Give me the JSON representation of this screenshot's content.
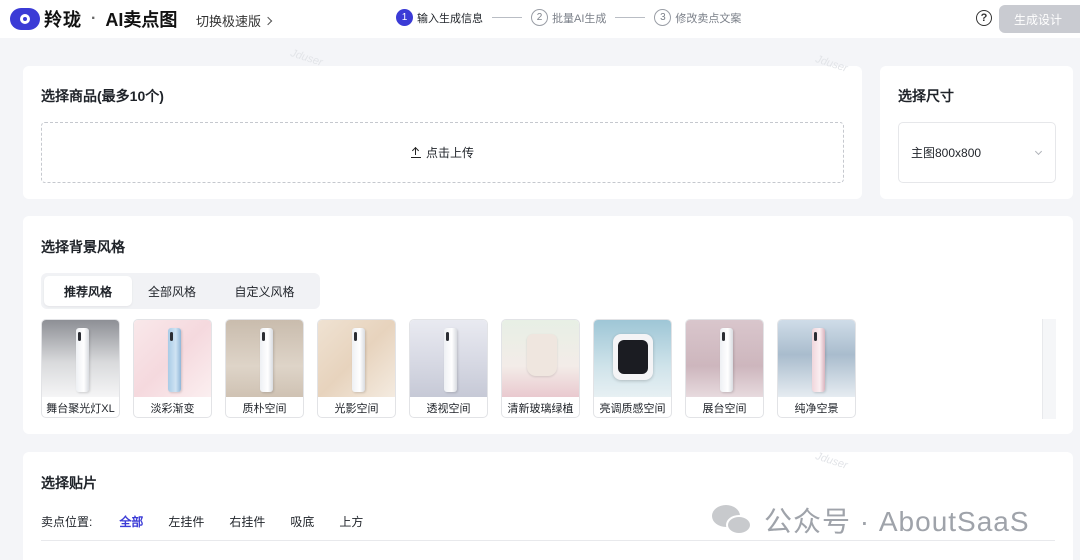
{
  "header": {
    "brand": "羚珑",
    "separator": "·",
    "product": "AI卖点图",
    "switch_label": "切换极速版",
    "steps": [
      {
        "num": "1",
        "label": "输入生成信息",
        "state": "active"
      },
      {
        "num": "2",
        "label": "批量AI生成",
        "state": "pending"
      },
      {
        "num": "3",
        "label": "修改卖点文案",
        "state": "pending"
      }
    ],
    "help_icon": "?",
    "generate_label": "生成设计"
  },
  "product_card": {
    "title": "选择商品(最多10个)",
    "upload_label": "点击上传"
  },
  "size_card": {
    "title": "选择尺寸",
    "selected": "主图800x800"
  },
  "style_card": {
    "title": "选择背景风格",
    "tabs": [
      {
        "label": "推荐风格",
        "active": true
      },
      {
        "label": "全部风格",
        "active": false
      },
      {
        "label": "自定义风格",
        "active": false
      }
    ],
    "styles": [
      {
        "label": "舞台聚光灯XL",
        "bg": "linear-gradient(180deg,#8d8f95 0%,#d9dadc 55%,#f5f5f6 100%)",
        "kind": "phone"
      },
      {
        "label": "淡彩渐变",
        "bg": "linear-gradient(135deg,#f9e8ea 0%,#f5d9de 50%,#fbeff0 100%)",
        "kind": "phone-blue"
      },
      {
        "label": "质朴空间",
        "bg": "linear-gradient(180deg,#c9bcad 0%,#ded4c8 60%,#cfc2b3 100%)",
        "kind": "phone"
      },
      {
        "label": "光影空间",
        "bg": "linear-gradient(135deg,#efe2d2 0%,#e7d3bd 50%,#f4ebe0 100%)",
        "kind": "phone"
      },
      {
        "label": "透视空间",
        "bg": "linear-gradient(180deg,#e9eaf1 0%,#d5d7e2 60%,#c6c9d6 100%)",
        "kind": "phone"
      },
      {
        "label": "清新玻璃绿植",
        "bg": "linear-gradient(180deg,#e7efe5 0%,#f3ece8 60%,#e9c9cf 100%)",
        "kind": "kettle"
      },
      {
        "label": "亮调质感空间",
        "bg": "linear-gradient(180deg,#9ec6d6 0%,#cfe3ea 60%,#e7f0f3 100%)",
        "kind": "watch"
      },
      {
        "label": "展台空间",
        "bg": "linear-gradient(180deg,#d9c6cc 0%,#cdb6bd 60%,#e7dade 100%)",
        "kind": "phone"
      },
      {
        "label": "纯净空景",
        "bg": "linear-gradient(180deg,#cfdce8 0%,#a9bccd 45%,#e6ecf1 100%)",
        "kind": "phone-pink"
      }
    ]
  },
  "sticker_card": {
    "title": "选择贴片",
    "position_label": "卖点位置:",
    "positions": [
      {
        "label": "全部",
        "active": true
      },
      {
        "label": "左挂件",
        "active": false
      },
      {
        "label": "右挂件",
        "active": false
      },
      {
        "label": "吸底",
        "active": false
      },
      {
        "label": "上方",
        "active": false
      }
    ]
  },
  "watermark": {
    "text": "公众号 · AboutSaaS",
    "faint": "Jduser"
  },
  "colors": {
    "accent": "#3b3bd6",
    "disabled_button": "#c9cbd1",
    "page_bg": "#f4f5f8"
  }
}
